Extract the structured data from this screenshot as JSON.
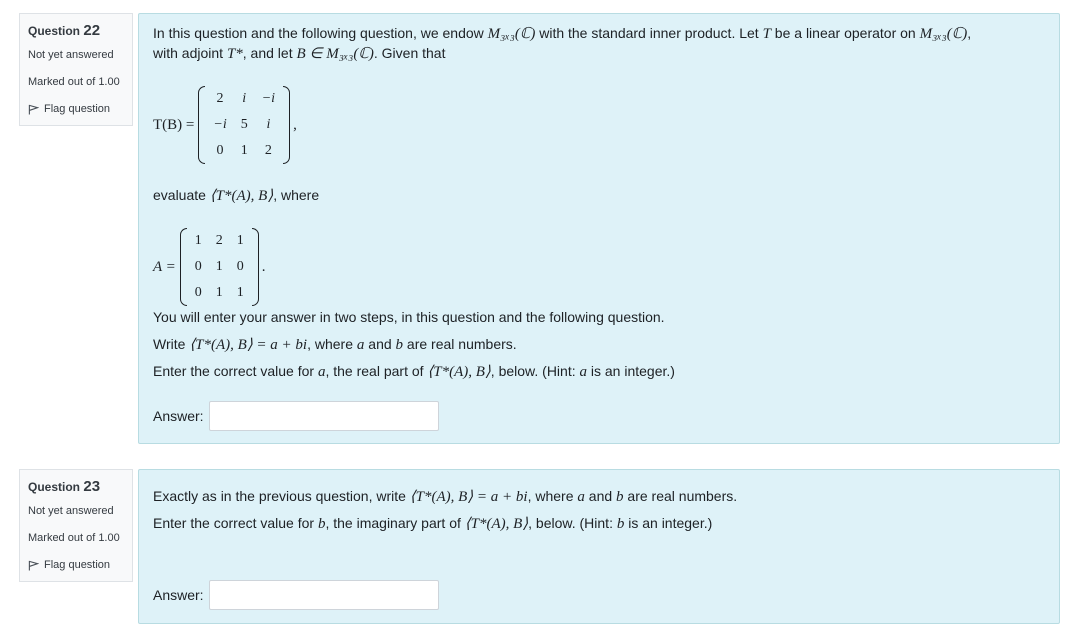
{
  "q22": {
    "label": "Question",
    "number": "22",
    "status": "Not yet answered",
    "marked": "Marked out of 1.00",
    "flag": "Flag question",
    "intro_a": "In this question and the following question, we endow ",
    "m3x3C": "M₃ₓ₃(ℂ)",
    "intro_b": " with the standard inner product. Let ",
    "T": "T",
    "intro_c": " be a linear operator on ",
    "intro_d": ",",
    "intro2_a": "with adjoint ",
    "Tstar": "T*",
    "intro2_b": ", and let ",
    "B_in": "B ∈ M₃ₓ₃(ℂ)",
    "intro2_c": ". Given that",
    "TB_lhs": "T(B) =",
    "TB_matrix": [
      [
        "2",
        "i",
        "−i"
      ],
      [
        "−i",
        "5",
        "i"
      ],
      [
        "0",
        "1",
        "2"
      ]
    ],
    "TB_punct": ",",
    "evaluate_a": "evaluate ",
    "evaluate_expr": "⟨T*(A), B⟩",
    "evaluate_b": ", where",
    "A_lhs": "A =",
    "A_matrix": [
      [
        "1",
        "2",
        "1"
      ],
      [
        "0",
        "1",
        "0"
      ],
      [
        "0",
        "1",
        "1"
      ]
    ],
    "A_punct": ".",
    "steps": "You will enter your answer in two steps, in this question and the following question.",
    "write_a": "Write ",
    "write_expr": "⟨T*(A), B⟩ = a + bi",
    "write_b": ", where ",
    "a": "a",
    "and": " and ",
    "b": "b",
    "write_c": " are real numbers.",
    "enter_a": "Enter the correct value for ",
    "enter_b": ", the real part of  ",
    "enter_expr": "⟨T*(A), B⟩",
    "enter_c": ", below. (Hint: ",
    "enter_d": " is an integer.)",
    "answer_label": "Answer:",
    "answer_value": ""
  },
  "q23": {
    "label": "Question",
    "number": "23",
    "status": "Not yet answered",
    "marked": "Marked out of 1.00",
    "flag": "Flag question",
    "line1_a": "Exactly as in the previous question, write ",
    "line1_expr": "⟨T*(A), B⟩ = a + bi",
    "line1_b": ", where ",
    "a": "a",
    "and": " and ",
    "b": "b",
    "line1_c": " are real numbers.",
    "line2_a": "Enter the correct value for ",
    "line2_b": ", the imaginary part of  ",
    "line2_expr": "⟨T*(A), B⟩",
    "line2_c": ", below. (Hint: ",
    "line2_d": " is an integer.)",
    "answer_label": "Answer:",
    "answer_value": ""
  }
}
